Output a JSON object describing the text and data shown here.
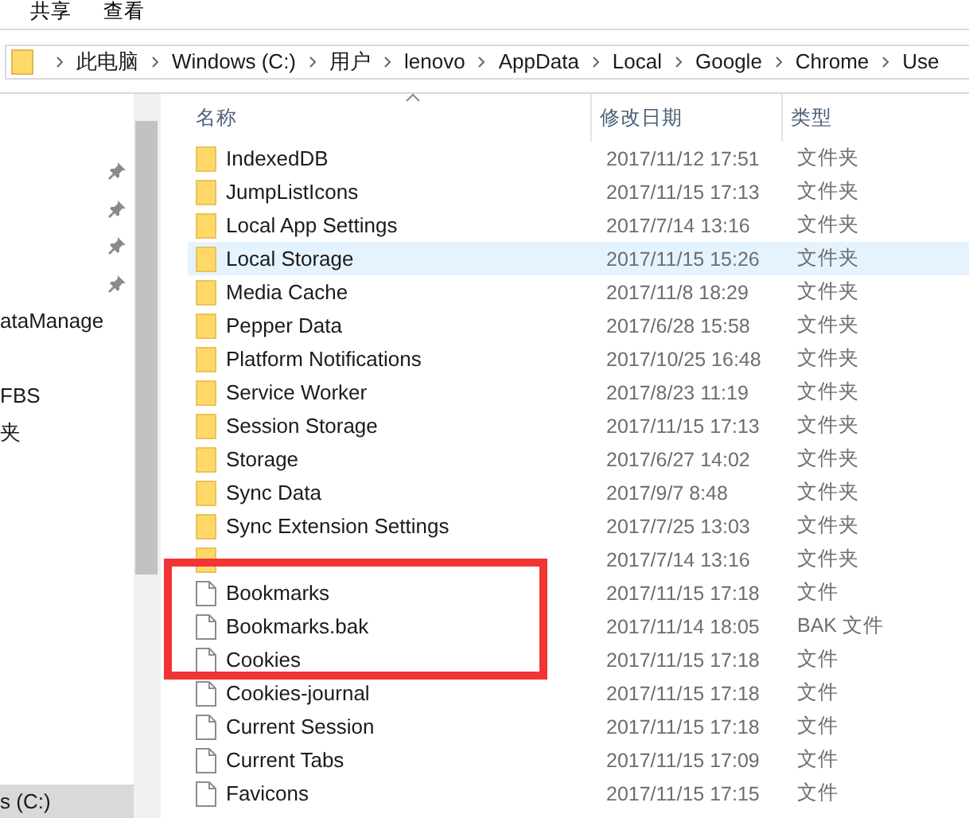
{
  "ribbon_tabs": [
    {
      "label": "共享"
    },
    {
      "label": "查看"
    }
  ],
  "address_bar": {
    "crumbs": [
      "此电脑",
      "Windows (C:)",
      "用户",
      "lenovo",
      "AppData",
      "Local",
      "Google",
      "Chrome",
      "Use"
    ]
  },
  "nav_pane": {
    "items": [
      {
        "pinned": true
      },
      {
        "pinned": true
      },
      {
        "pinned": true
      },
      {
        "pinned": true
      },
      {
        "label": "ataManage",
        "pinned": false
      },
      {
        "label": "FBS",
        "pinned": false
      },
      {
        "label": "夹",
        "pinned": false
      },
      {
        "label": "s (C:)",
        "pinned": false,
        "selected": true
      }
    ]
  },
  "table": {
    "columns": [
      "名称",
      "修改日期",
      "类型"
    ],
    "rows": [
      {
        "kind": "folder",
        "name": "IndexedDB",
        "date": "2017/11/12 17:51",
        "type": "文件夹",
        "selected": false
      },
      {
        "kind": "folder",
        "name": "JumpListIcons",
        "date": "2017/11/15 17:13",
        "type": "文件夹",
        "selected": false
      },
      {
        "kind": "folder",
        "name": "Local App Settings",
        "date": "2017/7/14 13:16",
        "type": "文件夹",
        "selected": false
      },
      {
        "kind": "folder",
        "name": "Local Storage",
        "date": "2017/11/15 15:26",
        "type": "文件夹",
        "selected": true
      },
      {
        "kind": "folder",
        "name": "Media Cache",
        "date": "2017/11/8 18:29",
        "type": "文件夹",
        "selected": false
      },
      {
        "kind": "folder",
        "name": "Pepper Data",
        "date": "2017/6/28 15:58",
        "type": "文件夹",
        "selected": false
      },
      {
        "kind": "folder",
        "name": "Platform Notifications",
        "date": "2017/10/25 16:48",
        "type": "文件夹",
        "selected": false
      },
      {
        "kind": "folder",
        "name": "Service Worker",
        "date": "2017/8/23 11:19",
        "type": "文件夹",
        "selected": false
      },
      {
        "kind": "folder",
        "name": "Session Storage",
        "date": "2017/11/15 17:13",
        "type": "文件夹",
        "selected": false
      },
      {
        "kind": "folder",
        "name": "Storage",
        "date": "2017/6/27 14:02",
        "type": "文件夹",
        "selected": false
      },
      {
        "kind": "folder",
        "name": "Sync Data",
        "date": "2017/9/7 8:48",
        "type": "文件夹",
        "selected": false
      },
      {
        "kind": "folder",
        "name": "Sync Extension Settings",
        "date": "2017/7/25 13:03",
        "type": "文件夹",
        "selected": false
      },
      {
        "kind": "folder",
        "date": "2017/7/14 13:16",
        "type": "文件夹",
        "selected": false
      },
      {
        "kind": "file",
        "name": "Bookmarks",
        "date": "2017/11/15 17:18",
        "type": "文件",
        "selected": false
      },
      {
        "kind": "file",
        "name": "Bookmarks.bak",
        "date": "2017/11/14 18:05",
        "type": "BAK 文件",
        "selected": false
      },
      {
        "kind": "file",
        "name": "Cookies",
        "date": "2017/11/15 17:18",
        "type": "文件",
        "selected": false
      },
      {
        "kind": "file",
        "name": "Cookies-journal",
        "date": "2017/11/15 17:18",
        "type": "文件",
        "selected": false
      },
      {
        "kind": "file",
        "name": "Current Session",
        "date": "2017/11/15 17:18",
        "type": "文件",
        "selected": false
      },
      {
        "kind": "file",
        "name": "Current Tabs",
        "date": "2017/11/15 17:09",
        "type": "文件",
        "selected": false
      },
      {
        "kind": "file",
        "name": "Favicons",
        "date": "2017/11/15 17:15",
        "type": "文件",
        "selected": false
      }
    ]
  }
}
